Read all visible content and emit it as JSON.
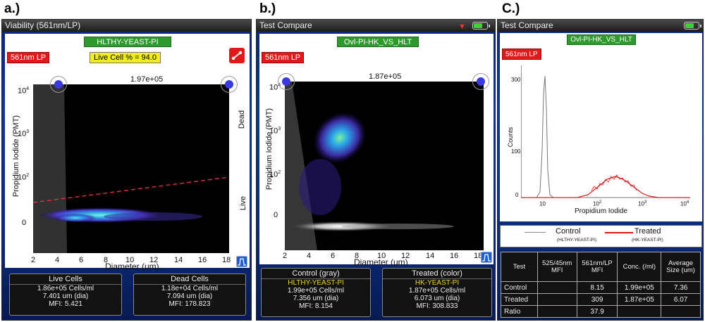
{
  "panels": {
    "a": {
      "letter": "a.)",
      "title": "Viability (561nm/LP)",
      "sample_label": "HLTHY-YEAST-PI",
      "laser_badge": "561nm LP",
      "live_cell_label": "Live Cell % = 94.0",
      "event_count": "1.97e+05",
      "y_axis_label": "Propidium Iodide (PMT)",
      "x_axis_label": "Diameter (um)",
      "y_ticks": [
        "10",
        "10",
        "10",
        "0"
      ],
      "y_exps": [
        "4",
        "3",
        "2",
        ""
      ],
      "x_ticks": [
        "2",
        "4",
        "6",
        "8",
        "10",
        "12",
        "14",
        "16",
        "18"
      ],
      "right_labels": [
        "Dead",
        "Live"
      ],
      "stats": [
        {
          "header": "Live Cells",
          "lines": [
            "1.86e+05 Cells/ml",
            "7.401 um (dia)",
            "MFI: 5.421"
          ]
        },
        {
          "header": "Dead Cells",
          "lines": [
            "1.18e+04 Cells/ml",
            "7.094 um (dia)",
            "MFI: 178.823"
          ]
        }
      ]
    },
    "b": {
      "letter": "b.)",
      "title": "Test Compare",
      "sample_label": "Ovl-PI-HK_VS_HLT",
      "laser_badge": "561nm LP",
      "event_count": "1.87e+05",
      "y_axis_label": "Propidium Iodide (PMT)",
      "x_axis_label": "Diameter (um)",
      "y_ticks": [
        "10",
        "10",
        "10",
        "0"
      ],
      "y_exps": [
        "4",
        "3",
        "2",
        ""
      ],
      "x_ticks": [
        "2",
        "4",
        "6",
        "8",
        "10",
        "12",
        "14",
        "16",
        "18"
      ],
      "stats": [
        {
          "header": "Control (gray)",
          "lines": [
            "HLTHY-YEAST-PI",
            "1.99e+05 Cells/ml",
            "7.356 um (dia)",
            "MFI: 8.154"
          ]
        },
        {
          "header": "Treated (color)",
          "lines": [
            "HK-YEAST-PI",
            "1.87e+05 Cells/ml",
            "6.073 um (dia)",
            "MFI: 308.833"
          ]
        }
      ]
    },
    "c": {
      "letter": "C.)",
      "title": "Test Compare",
      "sample_label": "Ovl-PI-HK_VS_HLT",
      "laser_badge": "561nm LP",
      "y_axis_label": "Counts",
      "x_axis_label": "Propidium Iodide",
      "y_ticks": [
        "300",
        "100",
        "0"
      ],
      "x_ticks": [
        "10",
        "10",
        "10",
        "10"
      ],
      "x_exps": [
        "",
        "2",
        "3",
        "4"
      ],
      "legend": [
        {
          "name": "Control",
          "sub": "(HLTHY-YEAST-PI)",
          "color": "#888888"
        },
        {
          "name": "Treated",
          "sub": "(HK-YEAST-PI)",
          "color": "#e01a1a"
        }
      ],
      "table": {
        "headers": [
          "Test",
          "525/45nm MFI",
          "561nm/LP MFI",
          "Conc. (/ml)",
          "Average Size (um)"
        ],
        "rows": [
          [
            "Control",
            "",
            "8.15",
            "1.99e+05",
            "7.36"
          ],
          [
            "Treated",
            "",
            "309",
            "1.87e+05",
            "6.07"
          ],
          [
            "Ratio",
            "",
            "37.9",
            "",
            ""
          ]
        ]
      }
    }
  },
  "colors": {
    "accent_green": "#2e9a2e",
    "badge_red": "#e01a1a",
    "highlight_yellow": "#f2ee1a",
    "device_blue": "#0a3a94"
  }
}
